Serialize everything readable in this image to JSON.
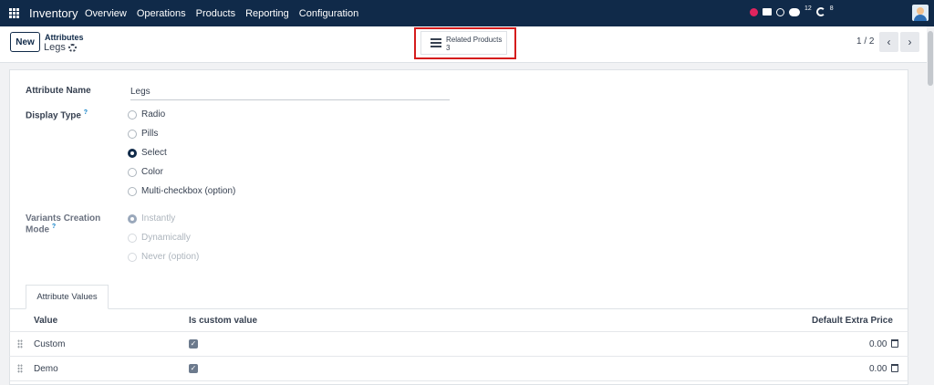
{
  "navbar": {
    "app_name": "Inventory",
    "menu": [
      "Overview",
      "Operations",
      "Products",
      "Reporting",
      "Configuration"
    ],
    "chat_count": "12",
    "activity_count": "8",
    "icons": [
      "apps-icon",
      "record-icon",
      "mail-icon",
      "whatsapp-icon",
      "chat-icon",
      "clock-icon",
      "avatar"
    ]
  },
  "control_panel": {
    "new_label": "New",
    "breadcrumb_parent": "Attributes",
    "breadcrumb_current": "Legs",
    "smart_button_label": "Related Products",
    "smart_button_count": "3",
    "pager": "1 / 2"
  },
  "form": {
    "attribute_name_label": "Attribute Name",
    "attribute_name_value": "Legs",
    "display_type_label": "Display Type",
    "help_mark": "?",
    "display_type_options": [
      "Radio",
      "Pills",
      "Select",
      "Color",
      "Multi-checkbox (option)"
    ],
    "display_type_selected": "Select",
    "variants_label_line1": "Variants Creation",
    "variants_label_line2": "Mode",
    "variants_options": [
      "Instantly",
      "Dynamically",
      "Never (option)"
    ],
    "variants_selected": "Instantly"
  },
  "values_tab": {
    "tab_label": "Attribute Values",
    "columns": [
      "Value",
      "Is custom value",
      "Default Extra Price"
    ],
    "rows": [
      {
        "value": "Custom",
        "is_custom": true,
        "price": "0.00"
      },
      {
        "value": "Demo",
        "is_custom": true,
        "price": "0.00"
      }
    ]
  },
  "colors": {
    "navbar": "#102a49",
    "highlight_box": "#d51c1c",
    "help_mark": "#0b7fc7"
  }
}
